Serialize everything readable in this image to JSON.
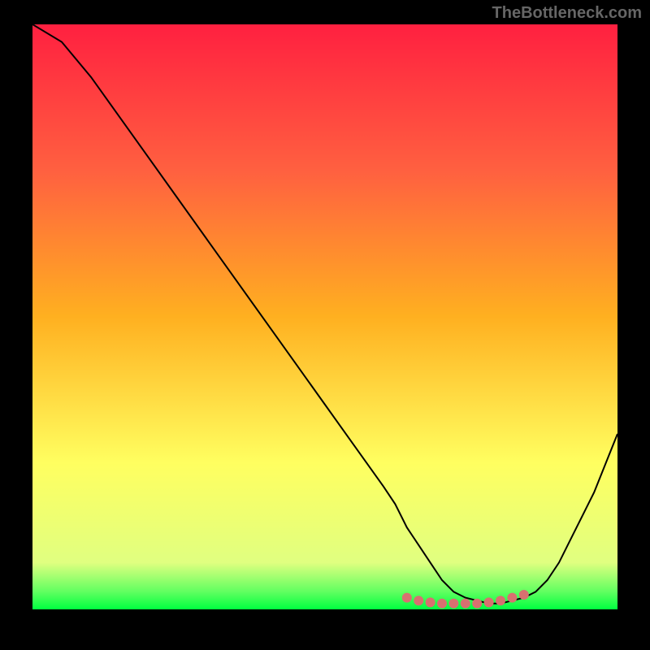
{
  "watermark": "TheBottleneck.com",
  "chart_data": {
    "type": "line",
    "title": "",
    "xlabel": "",
    "ylabel": "",
    "xlim": [
      0,
      100
    ],
    "ylim": [
      0,
      100
    ],
    "series": [
      {
        "name": "curve",
        "x": [
          0,
          5,
          10,
          15,
          20,
          25,
          30,
          35,
          40,
          45,
          50,
          55,
          60,
          62,
          64,
          66,
          68,
          70,
          72,
          74,
          76,
          78,
          80,
          82,
          84,
          86,
          88,
          90,
          92,
          94,
          96,
          98,
          100
        ],
        "y": [
          100,
          97,
          91,
          84,
          77,
          70,
          63,
          56,
          49,
          42,
          35,
          28,
          21,
          18,
          14,
          11,
          8,
          5,
          3,
          2,
          1.5,
          1,
          1,
          1.5,
          2,
          3,
          5,
          8,
          12,
          16,
          20,
          25,
          30
        ]
      }
    ],
    "markers": {
      "name": "highlight",
      "color": "#d87070",
      "points": [
        {
          "x": 64,
          "y": 2
        },
        {
          "x": 66,
          "y": 1.5
        },
        {
          "x": 68,
          "y": 1.2
        },
        {
          "x": 70,
          "y": 1
        },
        {
          "x": 72,
          "y": 1
        },
        {
          "x": 74,
          "y": 1
        },
        {
          "x": 76,
          "y": 1
        },
        {
          "x": 78,
          "y": 1.2
        },
        {
          "x": 80,
          "y": 1.5
        },
        {
          "x": 82,
          "y": 2
        },
        {
          "x": 84,
          "y": 2.5
        }
      ]
    },
    "gradient": {
      "colors": [
        {
          "offset": 0,
          "color": "#ff2040"
        },
        {
          "offset": 25,
          "color": "#ff6040"
        },
        {
          "offset": 50,
          "color": "#ffb020"
        },
        {
          "offset": 75,
          "color": "#ffff60"
        },
        {
          "offset": 92,
          "color": "#e0ff80"
        },
        {
          "offset": 97,
          "color": "#60ff60"
        },
        {
          "offset": 100,
          "color": "#00ff40"
        }
      ]
    }
  }
}
